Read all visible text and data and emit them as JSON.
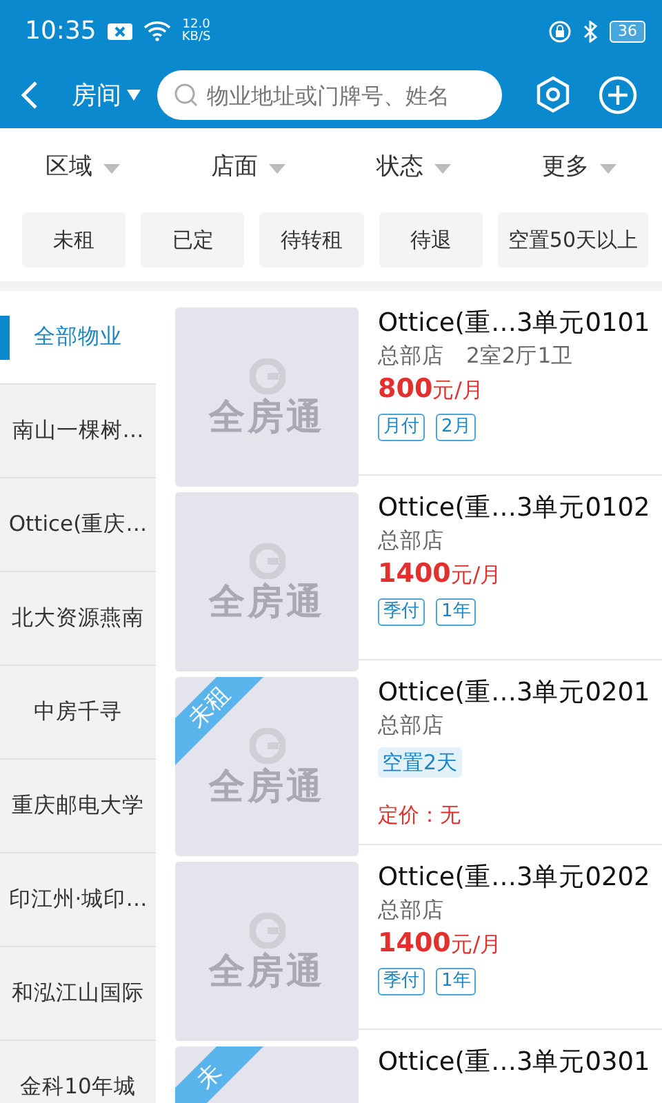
{
  "status_bar": {
    "time": "10:35",
    "speed": "12.0",
    "speed_unit": "KB/S",
    "battery": "36"
  },
  "header": {
    "title": "房间",
    "search": {
      "placeholder": "物业地址或门牌号、姓名"
    }
  },
  "filters": [
    {
      "label": "区域"
    },
    {
      "label": "店面"
    },
    {
      "label": "状态"
    },
    {
      "label": "更多"
    }
  ],
  "chips": [
    {
      "label": "未租",
      "selected": false
    },
    {
      "label": "已定",
      "selected": false
    },
    {
      "label": "待转租",
      "selected": false
    },
    {
      "label": "待退",
      "selected": false
    },
    {
      "label": "空置50天以上",
      "selected": false
    }
  ],
  "sidebar": {
    "items": [
      {
        "label": "全部物业",
        "selected": true
      },
      {
        "label": "南山一棵树…",
        "selected": false
      },
      {
        "label": "Ottice(重庆…",
        "selected": false
      },
      {
        "label": "北大资源燕南",
        "selected": false
      },
      {
        "label": "中房千寻",
        "selected": false
      },
      {
        "label": "重庆邮电大学",
        "selected": false
      },
      {
        "label": "印江州·城印…",
        "selected": false
      },
      {
        "label": "和泓江山国际",
        "selected": false
      },
      {
        "label": "金科10年城",
        "selected": false
      }
    ]
  },
  "listings": [
    {
      "logo": "全房通",
      "title": "Ottice(重…3单元0101",
      "store": "总部店",
      "layout": "2室2厅1卫",
      "price": "800",
      "unit": "元/月",
      "tags": [
        {
          "text": "月付",
          "kind": "outline"
        },
        {
          "text": "2月",
          "kind": "outline"
        }
      ]
    },
    {
      "logo": "全房通",
      "title": "Ottice(重…3单元0102",
      "store": "总部店",
      "price": "1400",
      "unit": "元/月",
      "tags": [
        {
          "text": "季付",
          "kind": "outline"
        },
        {
          "text": "1年",
          "kind": "outline"
        }
      ]
    },
    {
      "logo": "全房通",
      "ribbon": "未租",
      "title": "Ottice(重…3单元0201",
      "store": "总部店",
      "tags": [
        {
          "text": "空置2天",
          "kind": "filled"
        }
      ],
      "price_note": "定价：无"
    },
    {
      "logo": "全房通",
      "title": "Ottice(重…3单元0202",
      "store": "总部店",
      "price": "1400",
      "unit": "元/月",
      "tags": [
        {
          "text": "季付",
          "kind": "outline"
        },
        {
          "text": "1年",
          "kind": "outline"
        }
      ]
    },
    {
      "ribbon": "未",
      "title": "Ottice(重…3单元0301"
    }
  ]
}
